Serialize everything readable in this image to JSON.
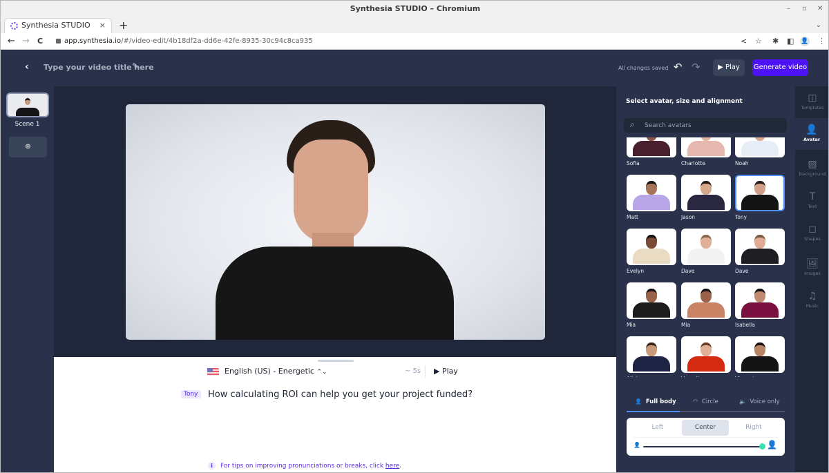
{
  "browser": {
    "window_title": "Synthesia STUDIO – Chromium",
    "tab_title": "Synthesia STUDIO",
    "url_host": "app.synthesia.io",
    "url_path": "/#/video-edit/4b18df2a-dd6e-42fe-8935-30c94c8ca935",
    "window_controls": {
      "minimize": "–",
      "maximize": "▫",
      "close": "✕"
    },
    "icons": {
      "back": "←",
      "forward": "→",
      "reload": "C",
      "share": "<",
      "star": "☆",
      "extensions": "✱",
      "sidepanel": "◧",
      "profile": "👤",
      "menu": "⋮",
      "new_tab": "+",
      "tab_close": "×",
      "tab_list": "⌄"
    }
  },
  "header": {
    "back_icon": "‹",
    "title_placeholder": "Type your video title here",
    "edit_icon": "✎",
    "save_status": "All changes saved",
    "undo_icon": "↶",
    "redo_icon": "↷",
    "play_label": "▶ Play",
    "generate_label": "Generate video",
    "accent_color": "#4d12f5"
  },
  "scenes": {
    "items": [
      {
        "label": "Scene 1"
      }
    ],
    "add_icon": "⊕"
  },
  "editor": {
    "voice": "English (US) - Energetic",
    "voice_chevron": "⌃⌄",
    "duration": "~ 5s",
    "play_label": "▶ Play",
    "avatar_chip": "Tony",
    "script": "How calculating ROI can help you get your project funded?",
    "tip_icon": "i",
    "tip_prefix": "For tips on improving pronunciations or breaks, click ",
    "tip_link": "here",
    "tip_suffix": "."
  },
  "avatar_panel": {
    "heading": "Select avatar, size and alignment",
    "search_placeholder": "Search avatars",
    "search_icon": "⌕",
    "selected": "Tony",
    "avatars": [
      {
        "name": "Sofia",
        "top": "#4a1f2e",
        "skin": "#8a5a48",
        "hair": "#2a1814"
      },
      {
        "name": "Charlotte",
        "top": "#e6b8b0",
        "skin": "#e3b8a0",
        "hair": "#5a2e22"
      },
      {
        "name": "Noah",
        "top": "#e8eef6",
        "skin": "#d8a890",
        "hair": "#6a4a34"
      },
      {
        "name": "Matt",
        "top": "#b9a6e8",
        "skin": "#a67458",
        "hair": "#1e1612"
      },
      {
        "name": "Jason",
        "top": "#2a2840",
        "skin": "#d6a88c",
        "hair": "#2a1c14"
      },
      {
        "name": "Tony",
        "top": "#141414",
        "skin": "#d0a088",
        "hair": "#2a1c14"
      },
      {
        "name": "Evelyn",
        "top": "#eadcc2",
        "skin": "#7a4a34",
        "hair": "#1a1210"
      },
      {
        "name": "Dave",
        "top": "#f2f2f2",
        "skin": "#e0b098",
        "hair": "#8a6a50"
      },
      {
        "name": "Dave",
        "top": "#1e1e22",
        "skin": "#e0ad94",
        "hair": "#7a5a40"
      },
      {
        "name": "Mia",
        "top": "#1c1c1c",
        "skin": "#9a6248",
        "hair": "#1a1210"
      },
      {
        "name": "Mia",
        "top": "#c98466",
        "skin": "#9a6248",
        "hair": "#1a1210"
      },
      {
        "name": "Isabella",
        "top": "#7a1040",
        "skin": "#c08a70",
        "hair": "#1a1210"
      },
      {
        "name": "Aliska",
        "top": "#1e2444",
        "skin": "#c89a7a",
        "hair": "#3a2418"
      },
      {
        "name": "Veronika",
        "top": "#d42a10",
        "skin": "#e0b098",
        "hair": "#6a4028"
      },
      {
        "name": "Vincent",
        "top": "#141414",
        "skin": "#b88466",
        "hair": "#1a1210"
      }
    ],
    "modes": [
      {
        "label": "Full body",
        "icon": "👤",
        "active": true
      },
      {
        "label": "Circle",
        "icon": "◠",
        "active": false
      },
      {
        "label": "Voice only",
        "icon": "🔈",
        "active": false
      }
    ],
    "alignment": [
      {
        "label": "Left",
        "active": false
      },
      {
        "label": "Center",
        "active": true
      },
      {
        "label": "Right",
        "active": false
      }
    ],
    "size_slider": {
      "value_fraction": 1.0,
      "min_icon": "👤",
      "max_icon": "👤",
      "knob_color": "#3be0b0"
    }
  },
  "rail": [
    {
      "label": "Templates",
      "icon": "◫",
      "active": false
    },
    {
      "label": "Avatar",
      "icon": "👤",
      "active": true
    },
    {
      "label": "Background",
      "icon": "▨",
      "active": false
    },
    {
      "label": "Text",
      "icon": "T",
      "active": false
    },
    {
      "label": "Shapes",
      "icon": "◻",
      "active": false
    },
    {
      "label": "Images",
      "icon": "🖼",
      "active": false
    },
    {
      "label": "Music",
      "icon": "♫",
      "active": false
    }
  ]
}
